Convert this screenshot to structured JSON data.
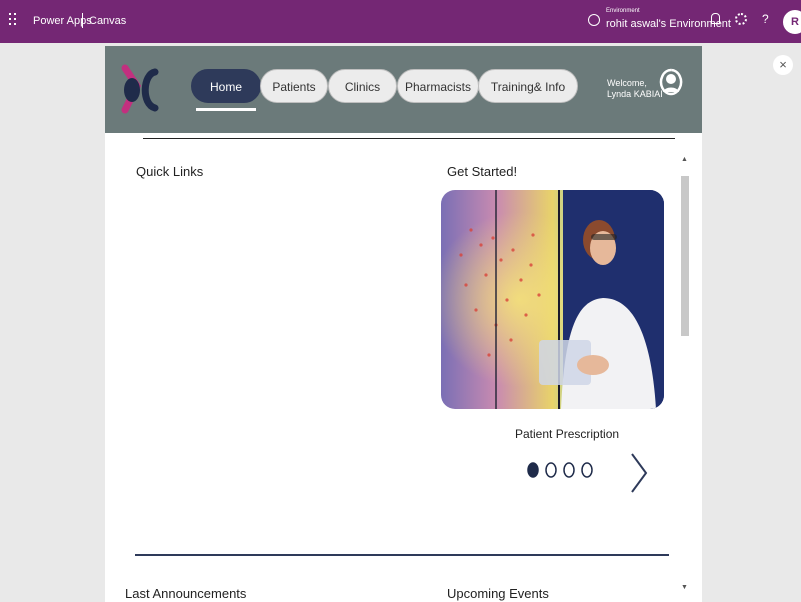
{
  "topbar": {
    "app_name": "Power Apps",
    "mode": "Canvas",
    "environment_label": "Environment",
    "environment_name": "rohit aswal's Environment",
    "help_label": "?",
    "avatar_initial": "R"
  },
  "app": {
    "nav": {
      "items": [
        {
          "label": "Home",
          "active": true
        },
        {
          "label": "Patients"
        },
        {
          "label": "Clinics"
        },
        {
          "label": "Pharmacists"
        },
        {
          "label": "Training& Info"
        }
      ]
    },
    "welcome": {
      "line1": "Welcome,",
      "line2": "Lynda KABIAI"
    },
    "quick_links_title": "Quick Links",
    "get_started_title": "Get Started!",
    "carousel": {
      "caption": "Patient Prescription",
      "slide_count": 4,
      "active_index": 0
    },
    "last_announcements_title": "Last Announcements",
    "upcoming_events_title": "Upcoming Events"
  },
  "close_label": "×",
  "colors": {
    "topbar": "#742774",
    "header": "#6b7a7a",
    "nav_active": "#2e3a5a",
    "logo_pink": "#c2307f",
    "logo_navy": "#1f2b4a"
  }
}
